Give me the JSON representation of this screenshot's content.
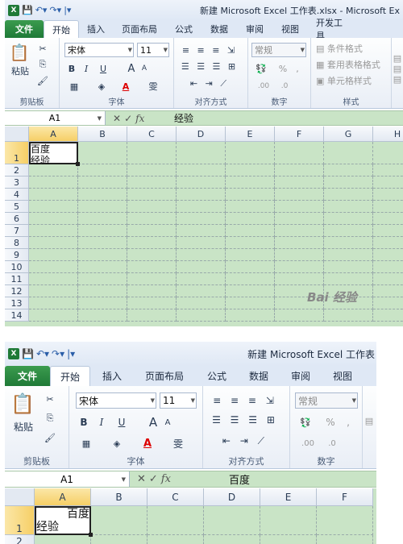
{
  "top": {
    "title": "新建 Microsoft Excel 工作表.xlsx - Microsoft Ex",
    "tabs": [
      "文件",
      "开始",
      "插入",
      "页面布局",
      "公式",
      "数据",
      "审阅",
      "视图",
      "开发工具"
    ],
    "clipboard": {
      "paste": "粘贴",
      "group": "剪贴板"
    },
    "font": {
      "name": "宋体",
      "size": "11",
      "group": "字体",
      "bold": "B",
      "italic": "I",
      "underline": "U",
      "grow": "A",
      "shrink": "A",
      "color_a": "A",
      "phonetic": "雯"
    },
    "align": {
      "group": "对齐方式"
    },
    "number": {
      "format": "常规",
      "percent": "%",
      "comma": ",",
      "inc": ".00",
      "dec": ".0",
      "group": "数字"
    },
    "styles": {
      "cond": "条件格式",
      "table": "套用表格格式",
      "cell": "单元格样式",
      "group": "样式"
    },
    "namebox": "A1",
    "fx": "fx",
    "formula": "经验",
    "cols": [
      "A",
      "B",
      "C",
      "D",
      "E",
      "F",
      "G",
      "H"
    ],
    "rows": [
      "1",
      "2",
      "3",
      "4",
      "5",
      "6",
      "7",
      "8",
      "9",
      "10",
      "11",
      "12",
      "13",
      "14"
    ],
    "a1_line1": "百度",
    "a1_line2": "经验",
    "watermark": "Bai 经验"
  },
  "bottom": {
    "title": "新建 Microsoft Excel 工作表",
    "tabs": [
      "文件",
      "开始",
      "插入",
      "页面布局",
      "公式",
      "数据",
      "审阅",
      "视图"
    ],
    "clipboard": {
      "paste": "粘贴",
      "group": "剪贴板"
    },
    "font": {
      "name": "宋体",
      "size": "11",
      "group": "字体",
      "bold": "B",
      "italic": "I",
      "underline": "U",
      "grow": "A",
      "shrink": "A",
      "color_a": "A",
      "phonetic": "雯"
    },
    "align": {
      "group": "对齐方式"
    },
    "number": {
      "format": "常规",
      "percent": "%",
      "comma": ",",
      "inc": ".00",
      "dec": ".0",
      "group": "数字"
    },
    "namebox": "A1",
    "fx": "fx",
    "formula": "百度",
    "cols": [
      "A",
      "B",
      "C",
      "D",
      "E",
      "F"
    ],
    "rows": [
      "1",
      "2"
    ],
    "a1_line1": "百度",
    "a1_line2": "经验"
  },
  "colors": {
    "file_tab": "#1f7a37",
    "grid": "#c9e4c6",
    "selected_header": "#f6cf66"
  }
}
